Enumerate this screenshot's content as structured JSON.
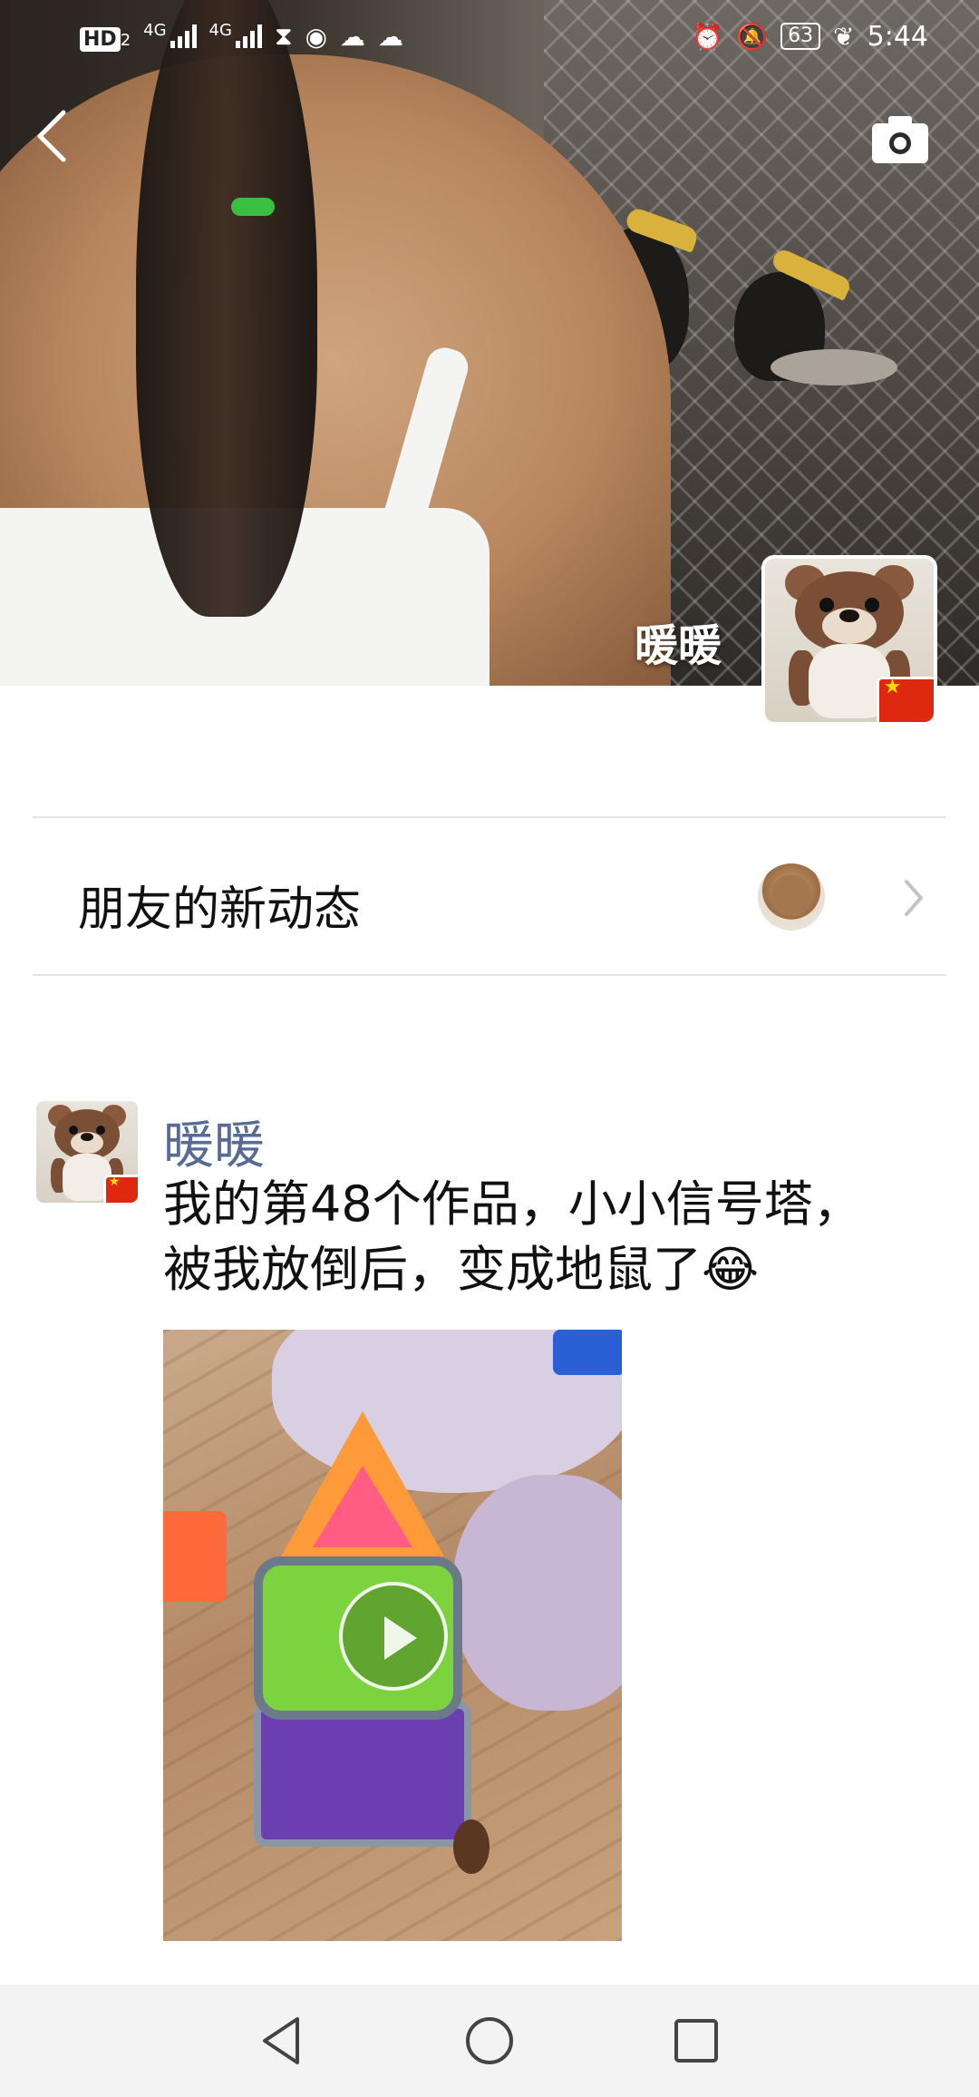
{
  "status_bar": {
    "left_chip": "HD",
    "left_chip_sub": "2",
    "network_1": "4G",
    "network_2": "4G",
    "battery": "63",
    "time": "5:44"
  },
  "profile": {
    "name": "暖暖"
  },
  "friend_updates": {
    "label": "朋友的新动态"
  },
  "post": {
    "author": "暖暖",
    "text": "我的第48个作品，小小信号塔，\n被我放倒后，变成地鼠了😂"
  },
  "icons": {
    "back": "back-icon",
    "camera": "camera-icon",
    "chevron": "chevron-right-icon",
    "play": "play-icon",
    "nav_back": "nav-back-icon",
    "nav_home": "nav-home-icon",
    "nav_recent": "nav-recent-icon"
  },
  "colors": {
    "name_link": "#576b95",
    "divider": "#e5e5e5",
    "navbar_bg": "#f3f3f3"
  }
}
